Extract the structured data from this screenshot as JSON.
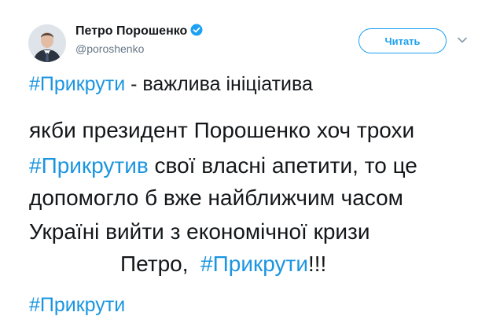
{
  "author": {
    "name": "Петро Порошенко",
    "handle": "@poroshenko",
    "verified": true,
    "avatar_icon": "user-avatar"
  },
  "actions": {
    "follow_label": "Читать",
    "menu_icon": "chevron-down-icon"
  },
  "tweet": {
    "intro_hashtag": "#Прикрути",
    "intro_text": " - важлива ініціатива",
    "line1": "якби президент Порошенко хоч трохи",
    "line2_hashtag": "#Прикрутив",
    "line2_text": " свої власні апетити, то це",
    "line3": "допомогло б вже найближчим часом",
    "line4": "Україні вийти з економічної кризи",
    "line5_text": "Петро,  ",
    "line5_hashtag": "#Прикрути",
    "line5_suffix": "!!!",
    "footer_hashtag": "#Прикрути"
  },
  "colors": {
    "link": "#1b95e0",
    "accent": "#1da1f2",
    "text": "#14171a",
    "muted": "#657786"
  }
}
